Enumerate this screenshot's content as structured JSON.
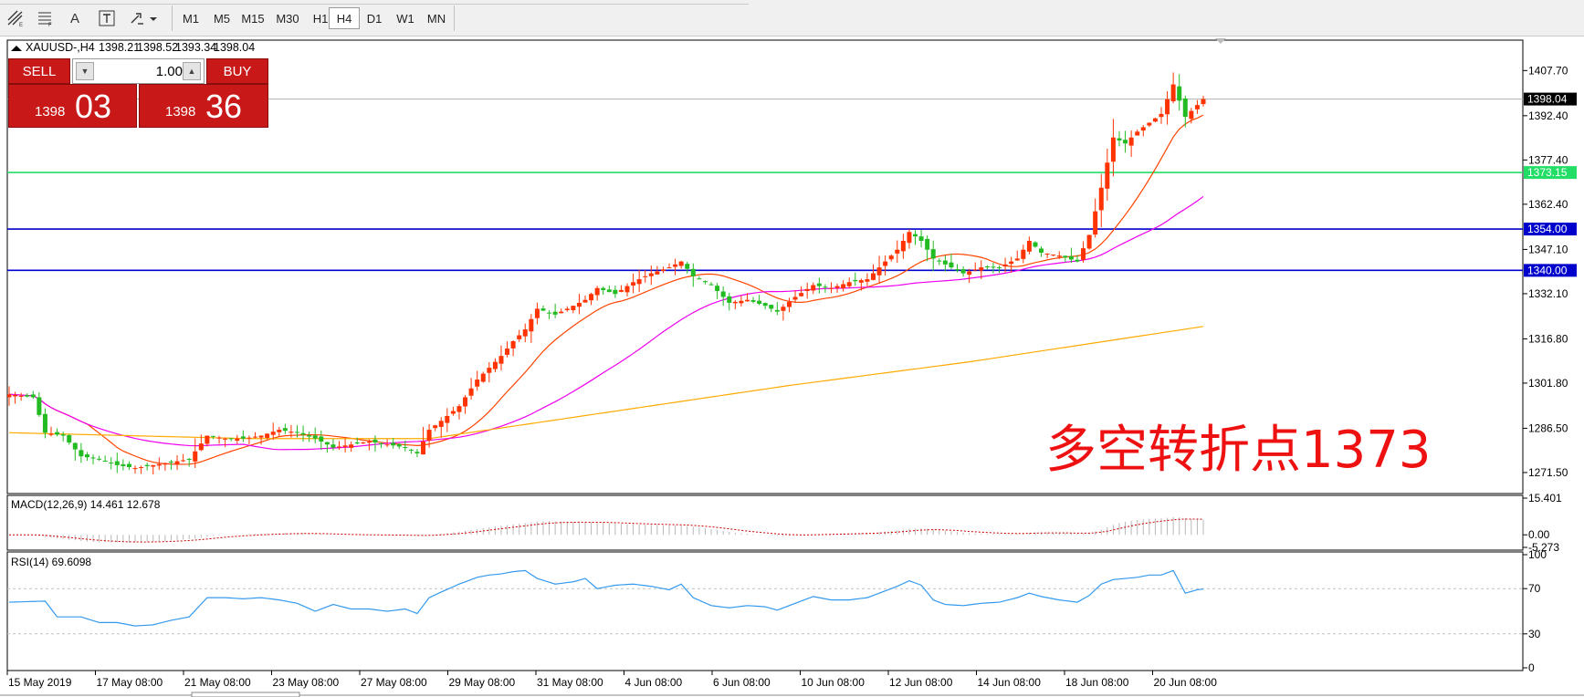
{
  "toolbar": {
    "tools": [
      {
        "icon": "line-studies-icon",
        "label": ""
      },
      {
        "icon": "fibonacci-icon",
        "label": ""
      },
      {
        "icon": "text-icon",
        "label": "A"
      },
      {
        "icon": "text-label-icon",
        "label": "T"
      },
      {
        "icon": "arrows-icon",
        "label": ""
      }
    ],
    "timeframes": [
      "M1",
      "M5",
      "M15",
      "M30",
      "H1",
      "H4",
      "D1",
      "W1",
      "MN"
    ],
    "active_timeframe": "H4"
  },
  "chart_header": {
    "symbol": "XAUUSD-,H4",
    "open": "1398.21",
    "high": "1398.52",
    "low": "1393.34",
    "close": "1398.04"
  },
  "trade_panel": {
    "sell_label": "SELL",
    "buy_label": "BUY",
    "lot": "1.00",
    "sell_price_small": "1398",
    "sell_price_big": "03",
    "buy_price_small": "1398",
    "buy_price_big": "36"
  },
  "annotation": "多空转折点1373",
  "colors": {
    "bull_candle": "#22bb22",
    "bear_candle": "#ff3300",
    "ma_fast": "#ff4400",
    "ma_mid": "#ee00ee",
    "ma_slow": "#ffaa00",
    "level_green": "#22dd66",
    "level_blue": "#0000cc",
    "macd_signal": "#cc0000",
    "rsi_line": "#3399ee",
    "annotation": "#ee1111"
  },
  "chart_data": [
    {
      "type": "candlestick",
      "panel": "main",
      "symbol": "XAUUSD-",
      "timeframe": "H4",
      "price_ticks": [
        "1407.70",
        "1392.40",
        "1377.40",
        "1362.40",
        "1347.10",
        "1332.10",
        "1316.80",
        "1301.80",
        "1286.50",
        "1271.50"
      ],
      "ylim": [
        1265,
        1418
      ],
      "current_price": "1398.04",
      "levels": [
        {
          "price": 1373.15,
          "label": "1373.15",
          "color": "green"
        },
        {
          "price": 1354.0,
          "label": "1354.00",
          "color": "blue"
        },
        {
          "price": 1340.0,
          "label": "1340.00",
          "color": "blue"
        }
      ],
      "date_ticks": [
        "15 May 2019",
        "17 May 08:00",
        "21 May 08:00",
        "23 May 08:00",
        "27 May 08:00",
        "29 May 08:00",
        "31 May 08:00",
        "4 Jun 08:00",
        "6 Jun 08:00",
        "10 Jun 08:00",
        "12 Jun 08:00",
        "14 Jun 08:00",
        "18 Jun 08:00",
        "20 Jun 08:00"
      ],
      "close_path": [
        [
          0,
          1298
        ],
        [
          4,
          1297
        ],
        [
          6,
          1285
        ],
        [
          9,
          1284
        ],
        [
          12,
          1277
        ],
        [
          15,
          1276
        ],
        [
          18,
          1274
        ],
        [
          21,
          1273
        ],
        [
          24,
          1274
        ],
        [
          27,
          1275
        ],
        [
          30,
          1276
        ],
        [
          33,
          1284
        ],
        [
          36,
          1283
        ],
        [
          39,
          1283
        ],
        [
          42,
          1284
        ],
        [
          45,
          1286
        ],
        [
          48,
          1285
        ],
        [
          51,
          1283
        ],
        [
          54,
          1280
        ],
        [
          57,
          1281
        ],
        [
          60,
          1282
        ],
        [
          63,
          1281
        ],
        [
          66,
          1280
        ],
        [
          68,
          1278
        ],
        [
          70,
          1286
        ],
        [
          72,
          1289
        ],
        [
          75,
          1294
        ],
        [
          78,
          1303
        ],
        [
          80,
          1307
        ],
        [
          82,
          1311
        ],
        [
          84,
          1316
        ],
        [
          86,
          1320
        ],
        [
          88,
          1327
        ],
        [
          91,
          1325
        ],
        [
          94,
          1328
        ],
        [
          96,
          1330
        ],
        [
          98,
          1334
        ],
        [
          101,
          1332
        ],
        [
          104,
          1336
        ],
        [
          107,
          1339
        ],
        [
          110,
          1341
        ],
        [
          112,
          1343
        ],
        [
          114,
          1338
        ],
        [
          117,
          1335
        ],
        [
          120,
          1329
        ],
        [
          123,
          1330
        ],
        [
          126,
          1328
        ],
        [
          128,
          1326
        ],
        [
          131,
          1331
        ],
        [
          134,
          1335
        ],
        [
          137,
          1334
        ],
        [
          140,
          1336
        ],
        [
          143,
          1337
        ],
        [
          146,
          1343
        ],
        [
          148,
          1347
        ],
        [
          150,
          1353
        ],
        [
          152,
          1350
        ],
        [
          154,
          1344
        ],
        [
          156,
          1342
        ],
        [
          159,
          1339
        ],
        [
          162,
          1341
        ],
        [
          165,
          1341
        ],
        [
          168,
          1344
        ],
        [
          170,
          1350
        ],
        [
          172,
          1346
        ],
        [
          175,
          1345
        ],
        [
          178,
          1343
        ],
        [
          180,
          1352
        ],
        [
          182,
          1368
        ],
        [
          184,
          1385
        ],
        [
          186,
          1383
        ],
        [
          188,
          1387
        ],
        [
          190,
          1390
        ],
        [
          192,
          1393
        ],
        [
          194,
          1403
        ],
        [
          196,
          1392
        ],
        [
          198,
          1396
        ],
        [
          199,
          1398.04
        ]
      ],
      "series": [
        {
          "name": "MA fast",
          "color": "ma_fast"
        },
        {
          "name": "MA mid",
          "color": "ma_mid"
        },
        {
          "name": "MA slow",
          "color": "ma_slow"
        }
      ],
      "ma_slow_path": [
        [
          0,
          1285
        ],
        [
          40,
          1283
        ],
        [
          70,
          1283
        ],
        [
          100,
          1292
        ],
        [
          130,
          1301
        ],
        [
          160,
          1309
        ],
        [
          199,
          1321
        ]
      ],
      "grid": false
    },
    {
      "type": "histogram+line",
      "panel": "macd",
      "title": "MACD(12,26,9) 14.461 12.678",
      "y_ticks": [
        "15.401",
        "0.00",
        "-5.273"
      ],
      "ylim": [
        -5.273,
        15.401
      ],
      "values_main_last": 14.461,
      "values_signal_last": 12.678
    },
    {
      "type": "line",
      "panel": "rsi",
      "title": "RSI(14) 69.6098",
      "y_ticks": [
        "100",
        "70",
        "30",
        "0"
      ],
      "ylim": [
        0,
        100
      ],
      "levels": [
        70,
        30
      ],
      "last_value": 69.6098,
      "path": [
        [
          0,
          58
        ],
        [
          6,
          59
        ],
        [
          8,
          45
        ],
        [
          12,
          45
        ],
        [
          15,
          40
        ],
        [
          18,
          40
        ],
        [
          21,
          37
        ],
        [
          24,
          38
        ],
        [
          27,
          42
        ],
        [
          30,
          45
        ],
        [
          33,
          62
        ],
        [
          36,
          62
        ],
        [
          39,
          61
        ],
        [
          42,
          62
        ],
        [
          45,
          60
        ],
        [
          48,
          57
        ],
        [
          51,
          50
        ],
        [
          54,
          56
        ],
        [
          57,
          52
        ],
        [
          60,
          52
        ],
        [
          63,
          50
        ],
        [
          66,
          52
        ],
        [
          68,
          48
        ],
        [
          70,
          62
        ],
        [
          72,
          67
        ],
        [
          75,
          74
        ],
        [
          78,
          80
        ],
        [
          80,
          82
        ],
        [
          82,
          83
        ],
        [
          84,
          85
        ],
        [
          86,
          86
        ],
        [
          88,
          79
        ],
        [
          91,
          74
        ],
        [
          94,
          76
        ],
        [
          96,
          79
        ],
        [
          98,
          70
        ],
        [
          101,
          73
        ],
        [
          104,
          74
        ],
        [
          107,
          72
        ],
        [
          110,
          69
        ],
        [
          112,
          74
        ],
        [
          114,
          62
        ],
        [
          117,
          55
        ],
        [
          120,
          53
        ],
        [
          123,
          55
        ],
        [
          126,
          54
        ],
        [
          128,
          51
        ],
        [
          131,
          57
        ],
        [
          134,
          63
        ],
        [
          137,
          60
        ],
        [
          140,
          60
        ],
        [
          143,
          62
        ],
        [
          146,
          68
        ],
        [
          148,
          72
        ],
        [
          150,
          77
        ],
        [
          152,
          73
        ],
        [
          154,
          60
        ],
        [
          156,
          56
        ],
        [
          159,
          55
        ],
        [
          162,
          57
        ],
        [
          165,
          58
        ],
        [
          168,
          62
        ],
        [
          170,
          66
        ],
        [
          172,
          63
        ],
        [
          175,
          60
        ],
        [
          178,
          58
        ],
        [
          180,
          64
        ],
        [
          182,
          74
        ],
        [
          184,
          78
        ],
        [
          186,
          79
        ],
        [
          188,
          80
        ],
        [
          190,
          82
        ],
        [
          192,
          82
        ],
        [
          194,
          86
        ],
        [
          196,
          66
        ],
        [
          198,
          69
        ],
        [
          199,
          69.6098
        ]
      ]
    }
  ]
}
